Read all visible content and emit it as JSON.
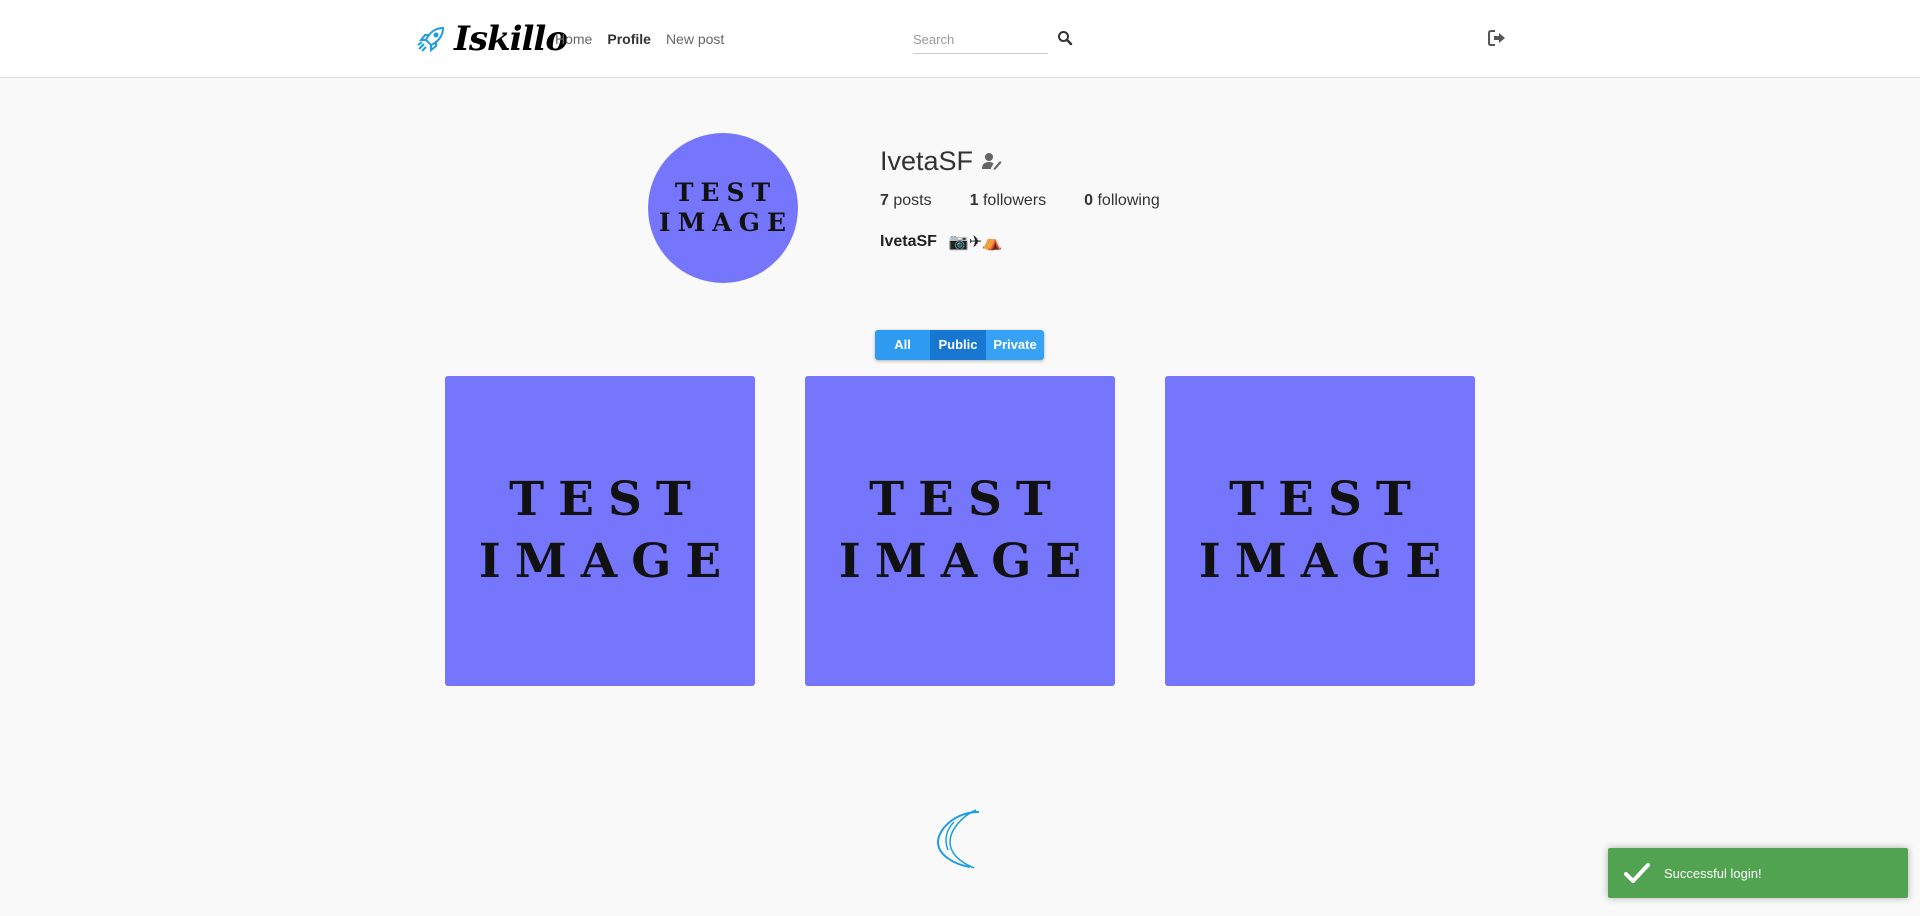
{
  "header": {
    "logo_text": "Iskillo",
    "nav": [
      {
        "label": "Home",
        "active": false
      },
      {
        "label": "Profile",
        "active": true
      },
      {
        "label": "New post",
        "active": false
      }
    ],
    "search": {
      "placeholder": "Search",
      "value": ""
    }
  },
  "profile": {
    "avatar_lines": [
      "TEST",
      "IMAGE"
    ],
    "username": "IvetaSF",
    "stats": {
      "posts_count": "7",
      "posts_label": "posts",
      "followers_count": "1",
      "followers_label": "followers",
      "following_count": "0",
      "following_label": "following"
    },
    "bio_name": "IvetaSF",
    "bio_emojis": "📷✈⛺"
  },
  "filter": {
    "all": "All",
    "public": "Public",
    "private": "Private",
    "selected": "Public"
  },
  "posts": [
    {
      "lines": [
        "TEST",
        "IMAGE"
      ]
    },
    {
      "lines": [
        "TEST",
        "IMAGE"
      ]
    },
    {
      "lines": [
        "TEST",
        "IMAGE"
      ]
    }
  ],
  "toast": {
    "message": "Successful login!"
  },
  "colors": {
    "image_bg": "#7676fd",
    "toggle_selected": "#1877d1",
    "toggle": "#2f9bf0",
    "toast": "#51a351",
    "logo_rocket": "#1e9ee0"
  }
}
